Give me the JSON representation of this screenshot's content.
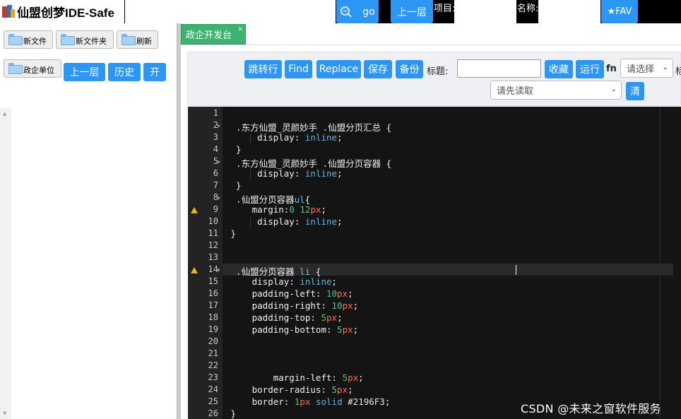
{
  "app": {
    "title": "仙盟创梦IDE-Safe"
  },
  "topbar": {
    "go_label": "go",
    "up_label": "上一层",
    "project_label": "项目:",
    "name_label": "名称:",
    "fav_label": "★FAV",
    "colors": {
      "bar": "#000000",
      "button": "#2b96f3"
    }
  },
  "sidebar": {
    "buttons": [
      {
        "label": "新文件"
      },
      {
        "label": "新文件夹"
      },
      {
        "label": "刷新"
      },
      {
        "label": "政企单位"
      }
    ],
    "up_label": "上一层",
    "history_label": "历史",
    "open_label": "开"
  },
  "tabs": [
    {
      "label": "政企开发台",
      "active": true
    }
  ],
  "toolbar": {
    "goto_label": "跳转行",
    "find_label": "Find",
    "replace_label": "Replace",
    "save_label": "保存",
    "backup_label": "备份",
    "title_label": "标题:",
    "title_value": "",
    "collect_label": "收藏",
    "run_label": "运行",
    "fn_label": "fn",
    "fn_select_value": "请选择",
    "cut_label": "标",
    "read_select_value": "请先读取",
    "clear_label": "清"
  },
  "editor": {
    "lines": [
      {
        "n": "1",
        "code": ""
      },
      {
        "n": "2",
        "fold": true,
        "code": "  .东方仙盟_灵颜妙手 .仙盟分页汇总 {"
      },
      {
        "n": "3",
        "code": "      display: inline;"
      },
      {
        "n": "4",
        "code": "  }"
      },
      {
        "n": "5",
        "fold": true,
        "code": "  .东方仙盟_灵颜妙手 .仙盟分页容器 {"
      },
      {
        "n": "6",
        "code": "      display: inline;"
      },
      {
        "n": "7",
        "code": "  }"
      },
      {
        "n": "8",
        "fold": true,
        "code": "  .仙盟分页容器ul{"
      },
      {
        "n": "9",
        "warn": true,
        "code": "     margin:0 12px;"
      },
      {
        "n": "10",
        "code": "      display: inline;"
      },
      {
        "n": "11",
        "code": " }"
      },
      {
        "n": "12",
        "code": ""
      },
      {
        "n": "13",
        "code": ""
      },
      {
        "n": "14",
        "warn": true,
        "fold": true,
        "code": "  .仙盟分页容器 li {"
      },
      {
        "n": "15",
        "code": "     display: inline;"
      },
      {
        "n": "16",
        "code": "     padding-left: 10px;"
      },
      {
        "n": "17",
        "code": "     padding-right: 10px;"
      },
      {
        "n": "18",
        "code": "     padding-top: 5px;"
      },
      {
        "n": "19",
        "code": "     padding-bottom: 5px;"
      },
      {
        "n": "20",
        "code": ""
      },
      {
        "n": "21",
        "code": ""
      },
      {
        "n": "22",
        "code": ""
      },
      {
        "n": "23",
        "code": "         margin-left: 5px;"
      },
      {
        "n": "24",
        "code": "     border-radius: 5px;"
      },
      {
        "n": "25",
        "code": "     border: 1px solid #2196F3;"
      },
      {
        "n": "26",
        "code": " }"
      }
    ],
    "colors": {
      "background": "#141414",
      "gutter": "#232323",
      "keyword": "#5fb5e6",
      "number": "#4ec98a",
      "unit": "#ff6b4b"
    }
  },
  "watermark": "CSDN @未来之窗软件服务"
}
